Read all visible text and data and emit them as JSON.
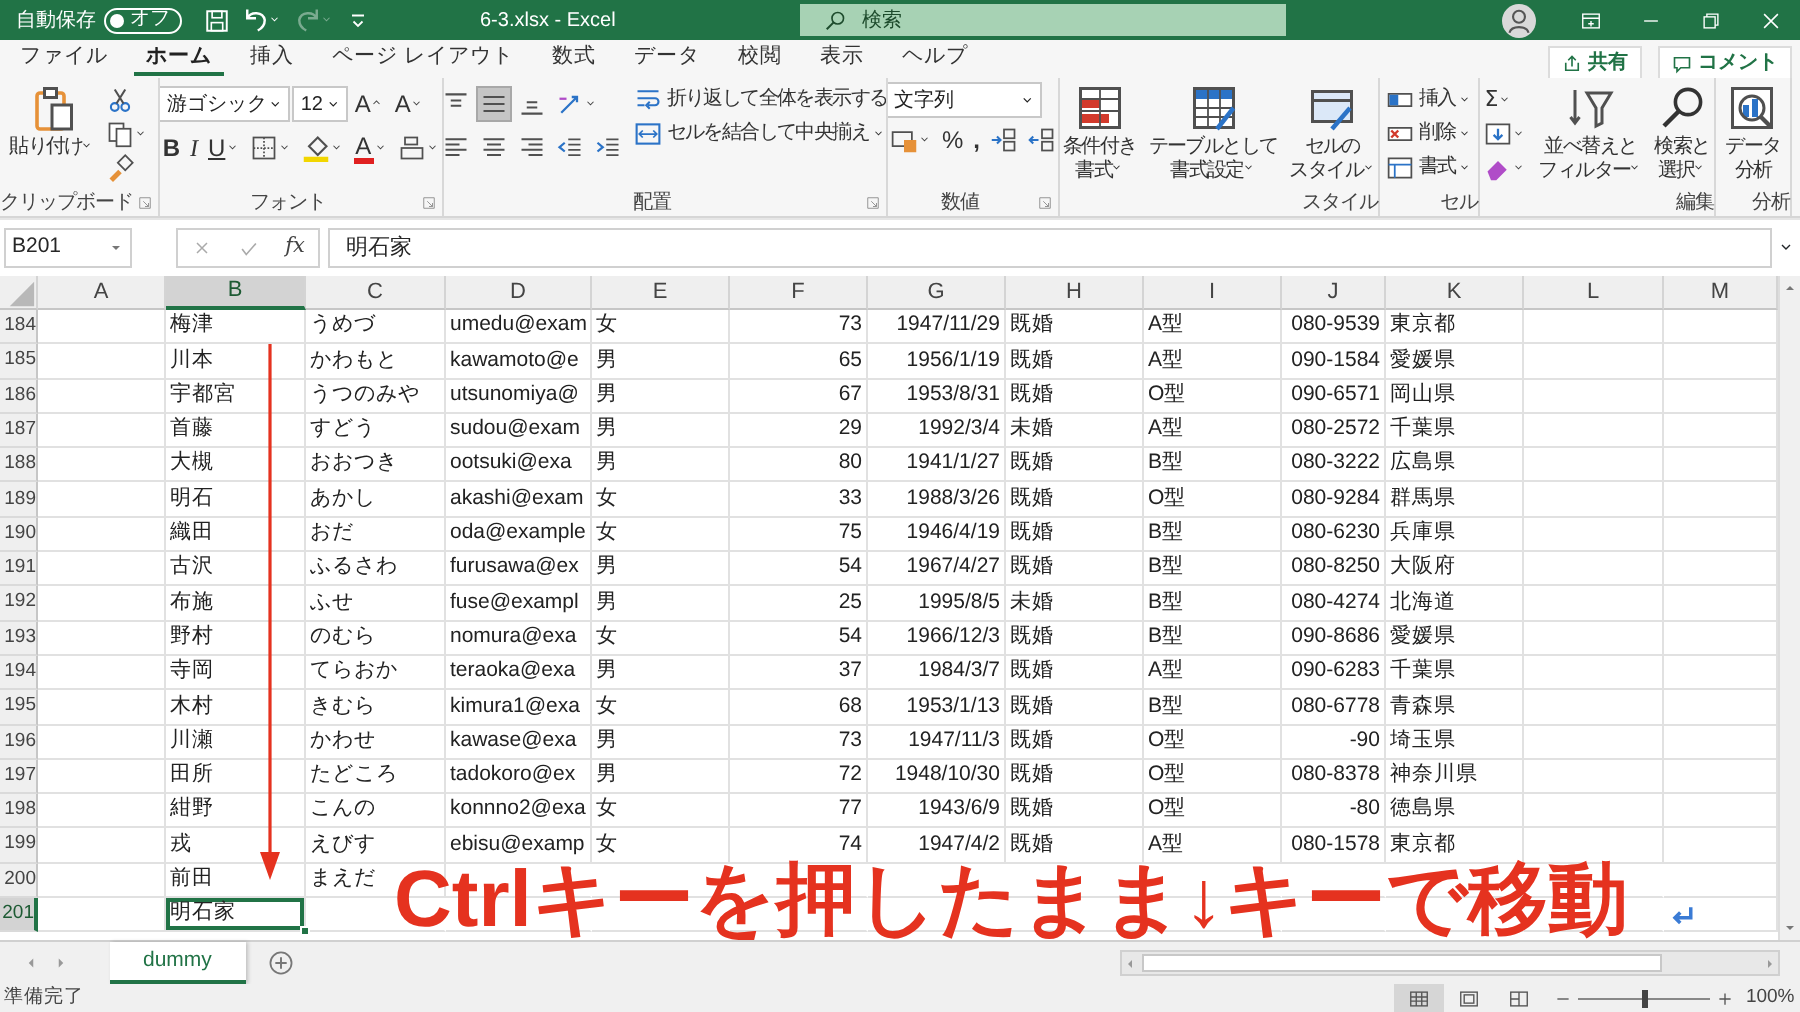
{
  "title_bar": {
    "autosave": {
      "label": "自動保存",
      "toggle_text": "オフ",
      "on": false
    },
    "undo": {
      "disabled": false
    },
    "redo": {
      "disabled": true
    },
    "document_title": "6-3.xlsx  -  Excel",
    "search": {
      "placeholder": "検索"
    }
  },
  "menu_tabs": [
    {
      "label": "ファイル",
      "selected": false
    },
    {
      "label": "ホーム",
      "selected": true
    },
    {
      "label": "挿入",
      "selected": false
    },
    {
      "label": "ページ レイアウト",
      "selected": false
    },
    {
      "label": "数式",
      "selected": false
    },
    {
      "label": "データ",
      "selected": false
    },
    {
      "label": "校閲",
      "selected": false
    },
    {
      "label": "表示",
      "selected": false
    },
    {
      "label": "ヘルプ",
      "selected": false
    }
  ],
  "share_button": "共有",
  "comment_button": "コメント",
  "ribbon": {
    "groups": [
      {
        "label": "クリップボード",
        "launcher": true,
        "cols": [
          [
            {
              "kind": "large",
              "lines": [
                "貼り付け"
              ],
              "dropdown": true
            }
          ],
          [
            {
              "kind": "icon"
            },
            {
              "kind": "icon",
              "dropdown": true
            },
            {
              "kind": "icon"
            }
          ]
        ]
      },
      {
        "label": "フォント",
        "launcher": true,
        "cols": [
          [
            {
              "kind": "row",
              "items": [
                {
                  "kind": "field",
                  "value": "游ゴシック",
                  "dropdown": true
                },
                {
                  "kind": "field",
                  "value": "12",
                  "dropdown": true
                },
                {
                  "kind": "grow-font",
                  "text": "A"
                },
                {
                  "kind": "shrink-font",
                  "text": "A"
                }
              ]
            },
            {
              "kind": "row",
              "items": [
                {
                  "kind": "bold",
                  "text": "B"
                },
                {
                  "kind": "italic",
                  "text": "I"
                },
                {
                  "kind": "underline",
                  "text": "U",
                  "dropdown": true
                },
                {
                  "kind": "icon",
                  "dropdown": true
                },
                {
                  "kind": "icon",
                  "dropdown": true
                },
                {
                  "kind": "font-color",
                  "text": "A",
                  "dropdown": true
                },
                {
                  "kind": "icon",
                  "dropdown": true
                }
              ]
            }
          ]
        ]
      },
      {
        "label": "配置",
        "launcher": true,
        "cols": [
          [
            {
              "kind": "row",
              "items": [
                {
                  "kind": "icon",
                  "selected": false
                },
                {
                  "kind": "icon",
                  "selected": true
                },
                {
                  "kind": "icon",
                  "selected": false
                },
                {
                  "kind": "icon",
                  "dropdown": true
                }
              ]
            },
            {
              "kind": "row",
              "items": [
                {
                  "kind": "icon",
                  "selected": false
                },
                {
                  "kind": "icon",
                  "selected": false
                },
                {
                  "kind": "icon",
                  "selected": false
                },
                {
                  "kind": "icon"
                },
                {
                  "kind": "icon"
                }
              ]
            }
          ],
          [
            {
              "kind": "small",
              "label": "折り返して全体を表示する"
            },
            {
              "kind": "small",
              "label": "セルを結合して中央揃え",
              "dropdown": true
            }
          ]
        ]
      },
      {
        "label": "数値",
        "launcher": true,
        "cols": [
          [
            {
              "kind": "field",
              "value": "文字列",
              "dropdown": true
            },
            {
              "kind": "row",
              "items": [
                {
                  "kind": "icon",
                  "dropdown": true
                },
                {
                  "kind": "glyph",
                  "text": "%"
                },
                {
                  "kind": "bold",
                  "text": ","
                },
                {
                  "kind": "icon"
                },
                {
                  "kind": "icon"
                }
              ]
            }
          ]
        ]
      },
      {
        "label": "スタイル",
        "cols": [
          [
            {
              "kind": "large",
              "lines": [
                "条件付き",
                "書式"
              ],
              "dropdown": true
            }
          ],
          [
            {
              "kind": "large",
              "lines": [
                "テーブルとして",
                "書式設定"
              ],
              "dropdown": true
            }
          ],
          [
            {
              "kind": "large",
              "lines": [
                "セルの",
                "スタイル"
              ],
              "dropdown": true
            }
          ]
        ]
      },
      {
        "label": "セル",
        "cols": [
          [
            {
              "kind": "small",
              "label": "挿入",
              "dropdown": true
            },
            {
              "kind": "small",
              "label": "削除",
              "dropdown": true
            },
            {
              "kind": "small",
              "label": "書式",
              "dropdown": true
            }
          ]
        ]
      },
      {
        "label": "編集",
        "cols": [
          [
            {
              "kind": "glyph",
              "text": "Σ",
              "dropdown": true
            },
            {
              "kind": "icon",
              "dropdown": true
            },
            {
              "kind": "icon",
              "dropdown": true
            }
          ],
          [
            {
              "kind": "large",
              "lines": [
                "並べ替えと",
                "フィルター"
              ],
              "dropdown": true
            }
          ],
          [
            {
              "kind": "large",
              "lines": [
                "検索と",
                "選択"
              ],
              "dropdown": true
            }
          ]
        ]
      },
      {
        "label": "分析",
        "cols": [
          [
            {
              "kind": "large",
              "lines": [
                "データ",
                "分析"
              ]
            }
          ]
        ]
      }
    ]
  },
  "formula_bar": {
    "name_box": "B201",
    "function_label": "fx",
    "value": "明石家"
  },
  "sheet": {
    "columns": [
      {
        "label": "A",
        "selected": false
      },
      {
        "label": "B",
        "selected": true
      },
      {
        "label": "C",
        "selected": false
      },
      {
        "label": "D",
        "selected": false
      },
      {
        "label": "E",
        "selected": false
      },
      {
        "label": "F",
        "selected": false
      },
      {
        "label": "G",
        "selected": false
      },
      {
        "label": "H",
        "selected": false
      },
      {
        "label": "I",
        "selected": false
      },
      {
        "label": "J",
        "selected": false
      },
      {
        "label": "K",
        "selected": false
      },
      {
        "label": "L",
        "selected": false
      },
      {
        "label": "M",
        "selected": false
      }
    ],
    "rows": [
      {
        "number": "184",
        "selected": false,
        "cells": [
          "",
          "梅津",
          "うめづ",
          "umedu@exam",
          "女",
          "73",
          "1947/11/29",
          "既婚",
          "A型",
          "080-9539",
          "東京都"
        ]
      },
      {
        "number": "185",
        "selected": false,
        "cells": [
          "",
          "川本",
          "かわもと",
          "kawamoto@e",
          "男",
          "65",
          "1956/1/19",
          "既婚",
          "A型",
          "090-1584",
          "愛媛県"
        ]
      },
      {
        "number": "186",
        "selected": false,
        "cells": [
          "",
          "宇都宮",
          "うつのみや",
          "utsunomiya@",
          "男",
          "67",
          "1953/8/31",
          "既婚",
          "O型",
          "090-6571",
          "岡山県"
        ]
      },
      {
        "number": "187",
        "selected": false,
        "cells": [
          "",
          "首藤",
          "すどう",
          "sudou@exam",
          "男",
          "29",
          "1992/3/4",
          "未婚",
          "A型",
          "080-2572",
          "千葉県"
        ]
      },
      {
        "number": "188",
        "selected": false,
        "cells": [
          "",
          "大槻",
          "おおつき",
          "ootsuki@exa",
          "男",
          "80",
          "1941/1/27",
          "既婚",
          "B型",
          "080-3222",
          "広島県"
        ]
      },
      {
        "number": "189",
        "selected": false,
        "cells": [
          "",
          "明石",
          "あかし",
          "akashi@exam",
          "女",
          "33",
          "1988/3/26",
          "既婚",
          "O型",
          "080-9284",
          "群馬県"
        ]
      },
      {
        "number": "190",
        "selected": false,
        "cells": [
          "",
          "織田",
          "おだ",
          "oda@example",
          "女",
          "75",
          "1946/4/19",
          "既婚",
          "B型",
          "080-6230",
          "兵庫県"
        ]
      },
      {
        "number": "191",
        "selected": false,
        "cells": [
          "",
          "古沢",
          "ふるさわ",
          "furusawa@ex",
          "男",
          "54",
          "1967/4/27",
          "既婚",
          "B型",
          "080-8250",
          "大阪府"
        ]
      },
      {
        "number": "192",
        "selected": false,
        "cells": [
          "",
          "布施",
          "ふせ",
          "fuse@exampl",
          "男",
          "25",
          "1995/8/5",
          "未婚",
          "B型",
          "080-4274",
          "北海道"
        ]
      },
      {
        "number": "193",
        "selected": false,
        "cells": [
          "",
          "野村",
          "のむら",
          "nomura@exa",
          "女",
          "54",
          "1966/12/3",
          "既婚",
          "B型",
          "090-8686",
          "愛媛県"
        ]
      },
      {
        "number": "194",
        "selected": false,
        "cells": [
          "",
          "寺岡",
          "てらおか",
          "teraoka@exa",
          "男",
          "37",
          "1984/3/7",
          "既婚",
          "A型",
          "090-6283",
          "千葉県"
        ]
      },
      {
        "number": "195",
        "selected": false,
        "cells": [
          "",
          "木村",
          "きむら",
          "kimura1@exa",
          "女",
          "68",
          "1953/1/13",
          "既婚",
          "B型",
          "080-6778",
          "青森県"
        ]
      },
      {
        "number": "196",
        "selected": false,
        "cells": [
          "",
          "川瀬",
          "かわせ",
          "kawase@exa",
          "男",
          "73",
          "1947/11/3",
          "既婚",
          "O型",
          "-90",
          "埼玉県"
        ]
      },
      {
        "number": "197",
        "selected": false,
        "cells": [
          "",
          "田所",
          "たどころ",
          "tadokoro@ex",
          "男",
          "72",
          "1948/10/30",
          "既婚",
          "O型",
          "080-8378",
          "神奈川県"
        ]
      },
      {
        "number": "198",
        "selected": false,
        "cells": [
          "",
          "紺野",
          "こんの",
          "konnno2@exa",
          "女",
          "77",
          "1943/6/9",
          "既婚",
          "O型",
          "-80",
          "徳島県"
        ]
      },
      {
        "number": "199",
        "selected": false,
        "cells": [
          "",
          "戎",
          "えびす",
          "ebisu@examp",
          "女",
          "74",
          "1947/4/2",
          "既婚",
          "A型",
          "080-1578",
          "東京都"
        ]
      },
      {
        "number": "200",
        "selected": false,
        "cells": [
          "",
          "前田",
          "まえだ"
        ]
      },
      {
        "number": "201",
        "selected": true,
        "cells": [
          "",
          "明石家"
        ]
      }
    ]
  },
  "annotation": {
    "text": "Ctrlキーを押したまま↓キーで移動"
  },
  "sheet_tabs": [
    {
      "label": "dummy",
      "selected": true
    }
  ],
  "status_bar": {
    "text": "準備完了",
    "views": [
      {
        "selected": true
      },
      {
        "selected": false
      },
      {
        "selected": false
      }
    ],
    "zoom": {
      "level": 0.5,
      "reading": "100%"
    }
  }
}
